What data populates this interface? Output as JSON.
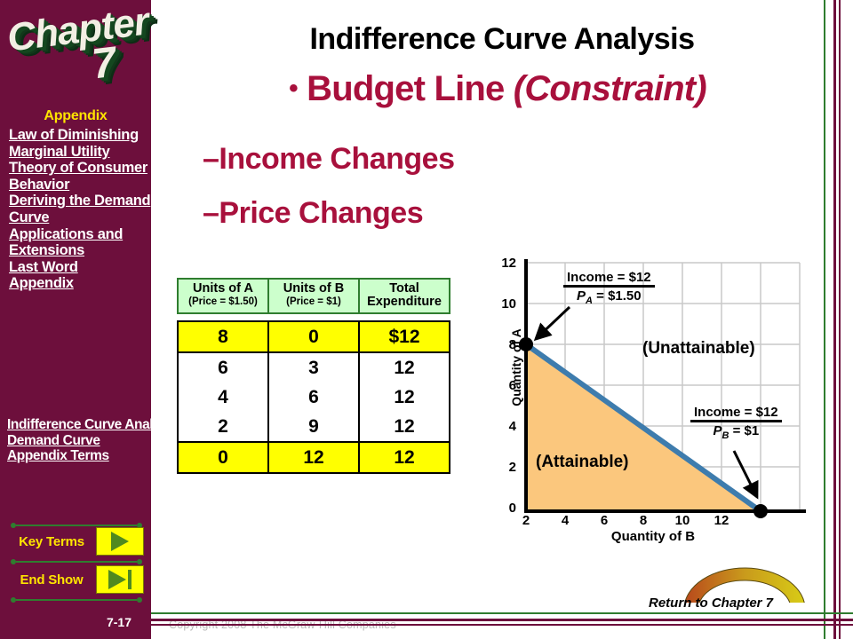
{
  "sidebar": {
    "chapter_word": "Chapter",
    "chapter_number": "7",
    "appendix_heading": "Appendix",
    "links": [
      "Law of Diminishing Marginal Utility",
      "Theory of Consumer Behavior",
      "Deriving the Demand Curve",
      "Applications and Extensions",
      "Last Word",
      "Appendix"
    ],
    "appendix_links": [
      "Indifference Curve Analysis",
      "Demand Curve",
      "Appendix Terms"
    ],
    "key_terms_label": "Key Terms",
    "end_show_label": "End Show",
    "slide_number": "7-17"
  },
  "header": {
    "title": "Indifference Curve Analysis",
    "bullet": "Budget Line",
    "bullet_italic": "(Constraint)",
    "sub_bullets": [
      "–Income Changes",
      "–Price Changes"
    ]
  },
  "table": {
    "headers": [
      {
        "main": "Units of A",
        "sub": "(Price = $1.50)"
      },
      {
        "main": "Units of B",
        "sub": "(Price = $1)"
      },
      {
        "main": "Total Expenditure",
        "sub": ""
      }
    ],
    "rows": [
      {
        "a": "8",
        "b": "0",
        "total": "$12",
        "highlight": true
      },
      {
        "a": "6",
        "b": "3",
        "total": "12",
        "highlight": false
      },
      {
        "a": "4",
        "b": "6",
        "total": "12",
        "highlight": false
      },
      {
        "a": "2",
        "b": "9",
        "total": "12",
        "highlight": false
      },
      {
        "a": "0",
        "b": "12",
        "total": "12",
        "highlight": true
      }
    ]
  },
  "chart_data": {
    "type": "line",
    "title": "",
    "xlabel": "Quantity of B",
    "ylabel": "Quantity of A",
    "xlim": [
      0,
      14
    ],
    "ylim": [
      0,
      12
    ],
    "xticks": [
      2,
      4,
      6,
      8,
      10,
      12
    ],
    "yticks": [
      0,
      2,
      4,
      6,
      8,
      10,
      12
    ],
    "grid": true,
    "legend": "none",
    "series": [
      {
        "name": "Budget Line",
        "x": [
          0,
          12
        ],
        "y": [
          8,
          0
        ],
        "color": "#3e7cad",
        "markers": [
          {
            "x": 0,
            "y": 8
          },
          {
            "x": 12,
            "y": 0
          }
        ]
      }
    ],
    "fill": {
      "label": "Attainable region",
      "color": "#fbc77d",
      "under_series": "Budget Line"
    },
    "annotations": [
      {
        "name": "vertical-intercept-formula",
        "numerator": "Income = $12",
        "denominator": "P_A = $1.50",
        "points_to": {
          "x": 0,
          "y": 8
        }
      },
      {
        "name": "horizontal-intercept-formula",
        "numerator": "Income = $12",
        "denominator": "P_B = $1",
        "points_to": {
          "x": 12,
          "y": 0
        }
      },
      {
        "name": "unattainable-label",
        "text": "(Unattainable)"
      },
      {
        "name": "attainable-label",
        "text": "(Attainable)"
      }
    ]
  },
  "chart_labels": {
    "unattainable": "(Unattainable)",
    "attainable": "(Attainable)",
    "annot1_num": "Income = $12",
    "annot1_den_p": "P",
    "annot1_den_sub": "A",
    "annot1_den_rest": " = $1.50",
    "annot2_num": "Income = $12",
    "annot2_den_p": "P",
    "annot2_den_sub": "B",
    "annot2_den_rest": " = $1"
  },
  "footer": {
    "return_label": "Return to Chapter 7",
    "copyright": "Copyright 2008 The McGraw-Hill Companies"
  },
  "colors": {
    "sidebar": "#6d0f3c",
    "accent_red": "#a8103c",
    "green": "#2f7d2f",
    "yellow": "#ffff00",
    "line_blue": "#3e7cad",
    "fill_orange": "#fbc77d"
  }
}
